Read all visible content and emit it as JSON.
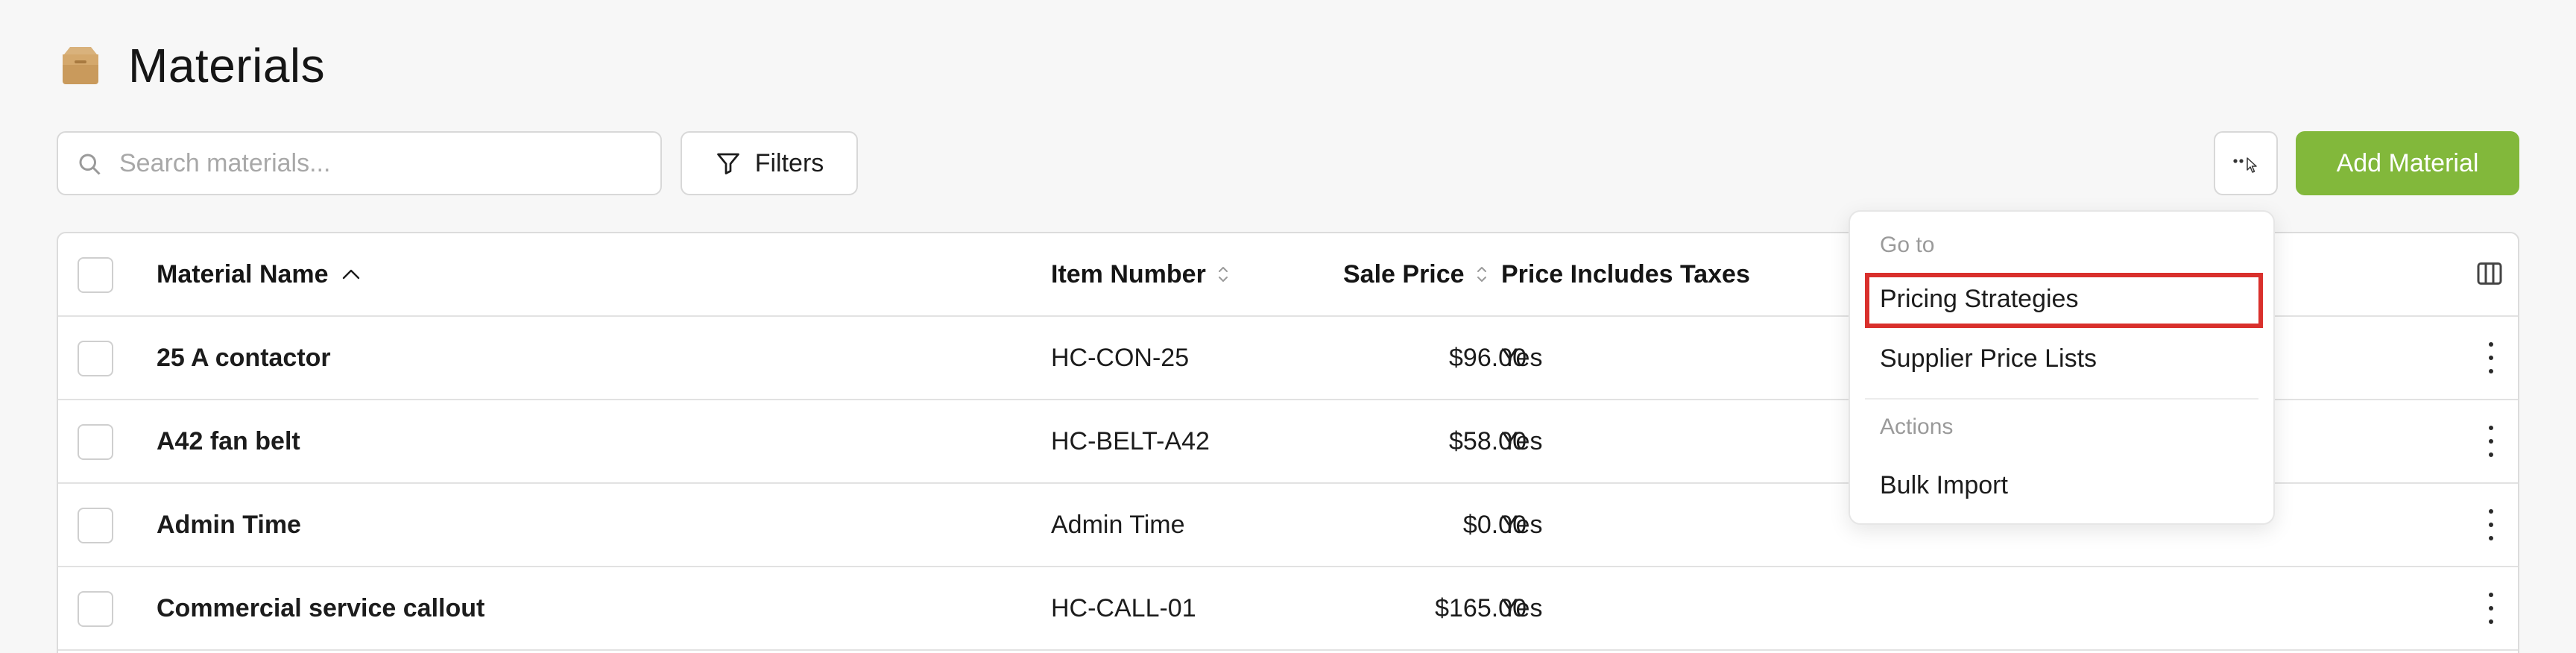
{
  "page": {
    "title": "Materials"
  },
  "toolbar": {
    "search_placeholder": "Search materials...",
    "filters_label": "Filters",
    "more_label": "...",
    "add_label": "Add Material"
  },
  "table": {
    "columns": [
      "Material Name",
      "Item Number",
      "Sale Price",
      "Price Includes Taxes"
    ],
    "rows": [
      {
        "name": "25 A contactor",
        "item": "HC-CON-25",
        "price": "$96.00",
        "tax": "Yes"
      },
      {
        "name": "A42 fan belt",
        "item": "HC-BELT-A42",
        "price": "$58.00",
        "tax": "Yes"
      },
      {
        "name": "Admin Time",
        "item": "Admin Time",
        "price": "$0.00",
        "tax": "Yes"
      },
      {
        "name": "Commercial service callout",
        "item": "HC-CALL-01",
        "price": "$165.00",
        "tax": "Yes"
      }
    ]
  },
  "menu": {
    "goto_header": "Go to",
    "goto_items": [
      "Pricing Strategies",
      "Supplier Price Lists"
    ],
    "actions_header": "Actions",
    "action_items": [
      "Bulk Import"
    ]
  },
  "colors": {
    "accent": "#82b83b",
    "highlight": "#d9302c"
  }
}
